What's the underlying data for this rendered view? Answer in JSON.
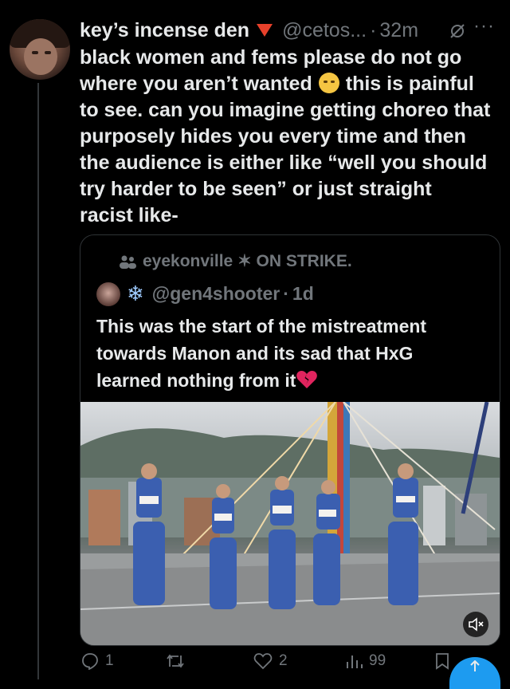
{
  "tweet": {
    "display_name": "key’s incense den",
    "handle": "@cetos...",
    "separator": "·",
    "time": "32m",
    "text_lines": [
      "black women and fems please do not go",
      "where you aren’t wanted",
      "this is painful",
      "to see. can you imagine getting choreo that",
      "purposely hides you every time and then",
      "the audience is either like “well you should",
      "try harder to be seen” or just straight",
      "racist like-"
    ]
  },
  "quote": {
    "context": "eyekonville ✶ ON STRIKE.",
    "handle": "@gen4shooter",
    "separator": "·",
    "time": "1d",
    "text_lines": [
      "This was the start of the mistreatment",
      "towards Manon and its sad that HxG",
      "learned nothing from it"
    ]
  },
  "actions": {
    "replies": "1",
    "likes": "2",
    "views": "99"
  },
  "colors": {
    "background": "#000000",
    "text": "#e7e9ea",
    "secondary": "#71767b",
    "border": "#2f3336",
    "accent": "#1d9bf0",
    "outfit": "#3b5fb0"
  },
  "icons": {
    "verified_flag": "red-triangle-icon",
    "mute": "muted-bell-icon",
    "more": "more-dots-icon",
    "retweet_context": "people-icon",
    "reply": "reply-icon",
    "retweet": "retweet-icon",
    "like": "heart-outline-icon",
    "views": "views-bar-chart-icon",
    "bookmark": "bookmark-icon",
    "share": "share-icon",
    "media_mute": "speaker-muted-icon"
  }
}
